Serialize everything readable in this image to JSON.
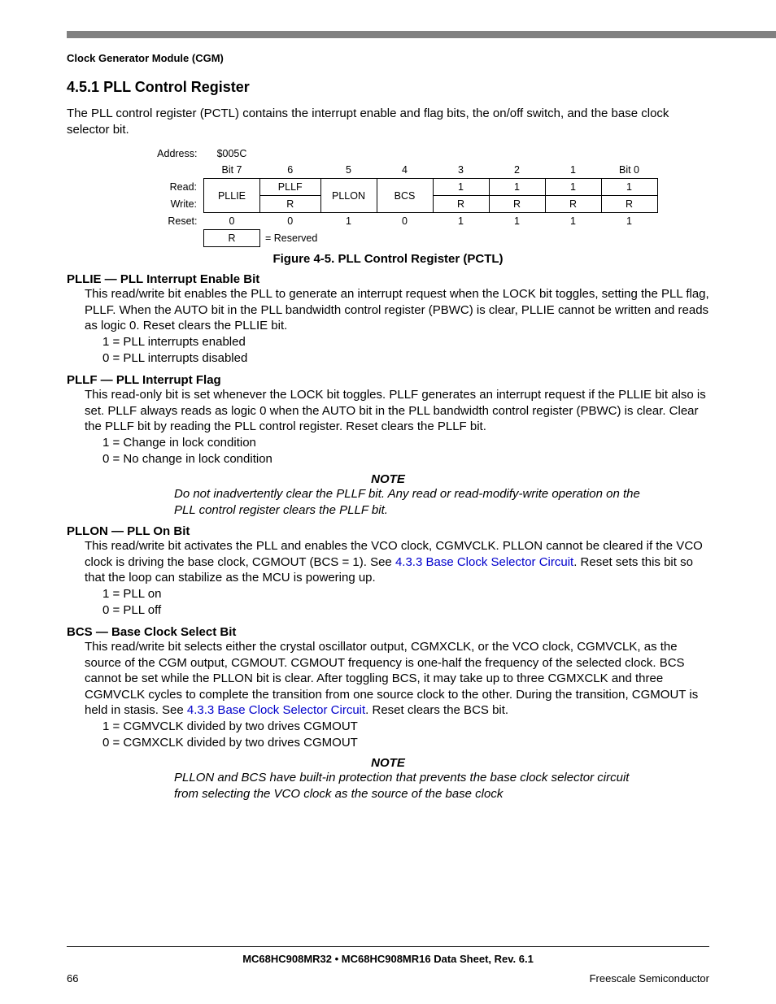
{
  "chapter_header": "Clock Generator Module (CGM)",
  "section": {
    "number": "4.5.1",
    "title": "PLL Control Register",
    "intro": "The PLL control register (PCTL) contains the interrupt enable and flag bits, the on/off switch, and the base clock selector bit."
  },
  "register": {
    "address_label": "Address:",
    "address_value": "$005C",
    "bit_header_label": "",
    "bits": [
      "Bit 7",
      "6",
      "5",
      "4",
      "3",
      "2",
      "1",
      "Bit 0"
    ],
    "read_label": "Read:",
    "write_label": "Write:",
    "reset_label": "Reset:",
    "cells": {
      "b7": "PLLIE",
      "b6_read": "PLLF",
      "b6_write": "R",
      "b5": "PLLON",
      "b4": "BCS",
      "b3_read": "1",
      "b3_write": "R",
      "b2_read": "1",
      "b2_write": "R",
      "b1_read": "1",
      "b1_write": "R",
      "b0_read": "1",
      "b0_write": "R"
    },
    "reset": [
      "0",
      "0",
      "1",
      "0",
      "1",
      "1",
      "1",
      "1"
    ],
    "legend_symbol": "R",
    "legend_text": "= Reserved",
    "caption": "Figure 4-5. PLL Control Register (PCTL)"
  },
  "fields": {
    "pllie": {
      "title": "PLLIE — PLL Interrupt Enable Bit",
      "desc": "This read/write bit enables the PLL to generate an interrupt request when the LOCK bit toggles, setting the PLL flag, PLLF. When the AUTO bit in the PLL bandwidth control register (PBWC) is clear, PLLIE cannot be written and reads as logic 0. Reset clears the PLLIE bit.",
      "v1": "1 = PLL interrupts enabled",
      "v0": "0 = PLL interrupts disabled"
    },
    "pllf": {
      "title": "PLLF — PLL Interrupt Flag",
      "desc": "This read-only bit is set whenever the LOCK bit toggles. PLLF generates an interrupt request if the PLLIE bit also is set. PLLF always reads as logic 0 when the AUTO bit in the PLL bandwidth control register (PBWC) is clear. Clear the PLLF bit by reading the PLL control register. Reset clears the PLLF bit.",
      "v1": "1 = Change in lock condition",
      "v0": "0 = No change in lock condition",
      "note_title": "NOTE",
      "note_body": "Do not inadvertently clear the PLLF bit. Any read or read-modify-write operation on the PLL control register clears the PLLF bit."
    },
    "pllon": {
      "title": "PLLON — PLL On Bit",
      "desc_pre": "This read/write bit activates the PLL and enables the VCO clock, CGMVCLK. PLLON cannot be cleared if the VCO clock is driving the base clock, CGMOUT (BCS = 1). See ",
      "link": "4.3.3 Base Clock Selector Circuit",
      "desc_post": ". Reset sets this bit so that the loop can stabilize as the MCU is powering up.",
      "v1": "1 = PLL on",
      "v0": "0 = PLL off"
    },
    "bcs": {
      "title": "BCS — Base Clock Select Bit",
      "desc_pre": "This read/write bit selects either the crystal oscillator output, CGMXCLK, or the VCO clock, CGMVCLK, as the source of the CGM output, CGMOUT. CGMOUT frequency is one-half the frequency of the selected clock. BCS cannot be set while the PLLON bit is clear. After toggling BCS, it may take up to three CGMXCLK and three CGMVCLK cycles to complete the transition from one source clock to the other. During the transition, CGMOUT is held in stasis. See ",
      "link": "4.3.3 Base Clock Selector Circuit",
      "desc_post": ". Reset clears the BCS bit.",
      "v1": "1 = CGMVCLK divided by two drives CGMOUT",
      "v0": "0 = CGMXCLK divided by two drives CGMOUT",
      "note_title": "NOTE",
      "note_body": "PLLON and BCS have built-in protection that prevents the base clock selector circuit from selecting the VCO clock as the source of the base clock"
    }
  },
  "footer": {
    "title": "MC68HC908MR32 • MC68HC908MR16 Data Sheet, Rev. 6.1",
    "page": "66",
    "vendor": "Freescale Semiconductor"
  }
}
